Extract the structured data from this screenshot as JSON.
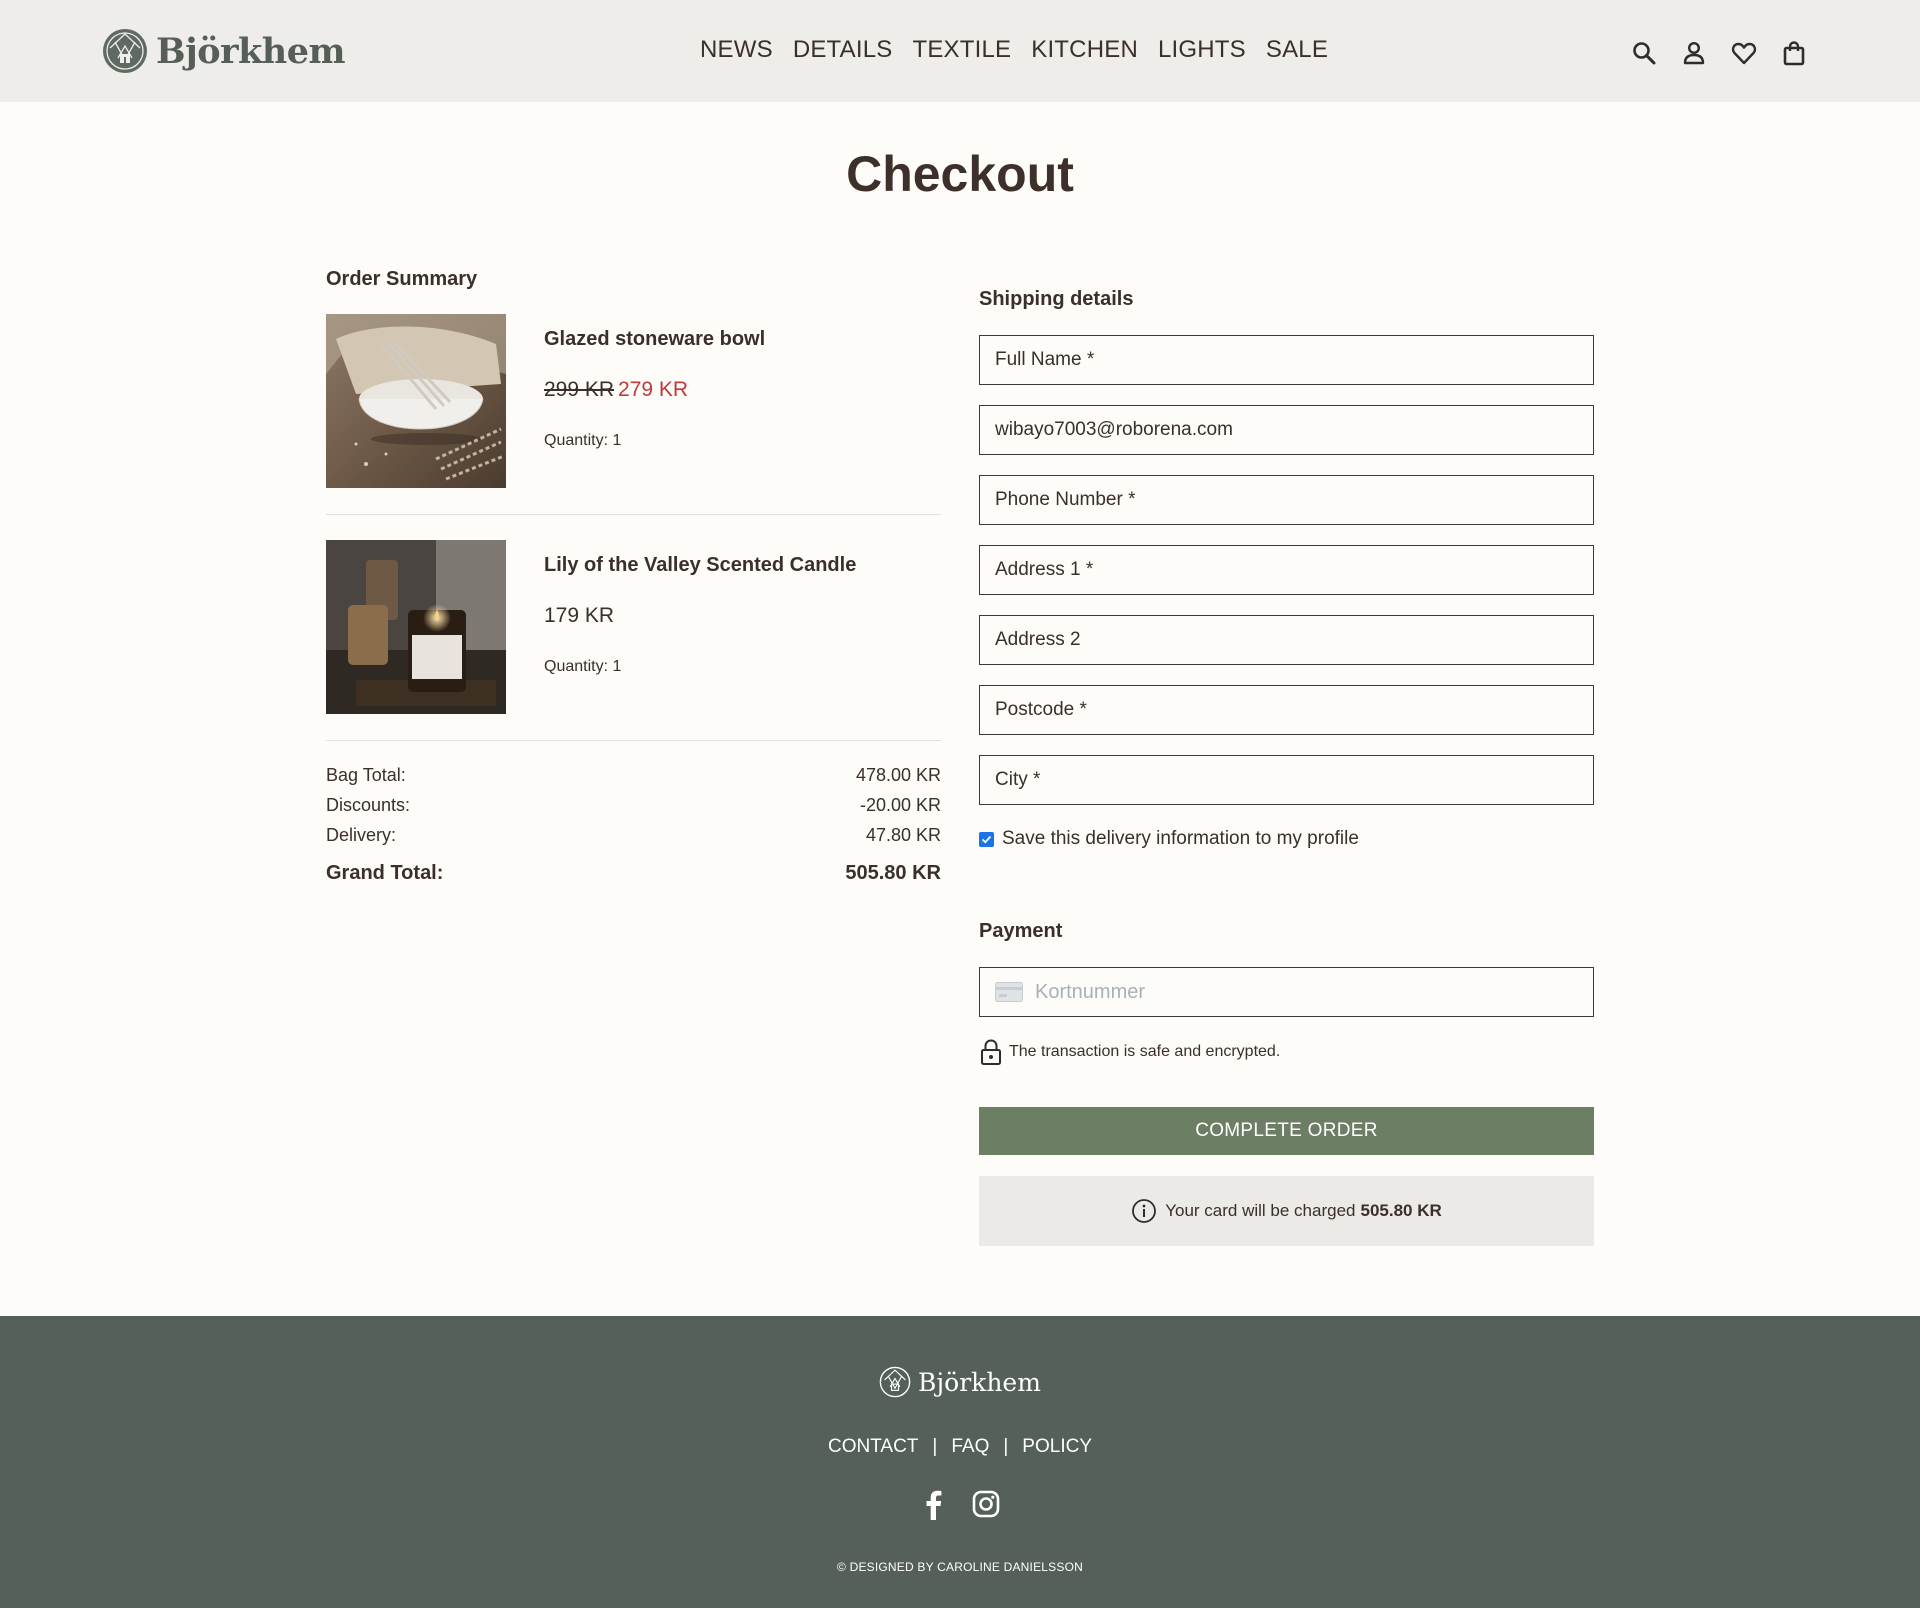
{
  "brand": {
    "name": "Björkhem"
  },
  "nav": [
    "NEWS",
    "DETAILS",
    "TEXTILE",
    "KITCHEN",
    "LIGHTS",
    "SALE"
  ],
  "header_icons": [
    "search-icon",
    "user-icon",
    "heart-icon",
    "bag-icon"
  ],
  "page": {
    "title": "Checkout"
  },
  "order": {
    "heading": "Order Summary",
    "items": [
      {
        "name": "Glazed stoneware bowl",
        "old_price": "299 KR",
        "price": "279 KR",
        "quantity": "Quantity: 1"
      },
      {
        "name": "Lily of the Valley Scented Candle",
        "price": "179 KR",
        "quantity": "Quantity: 1"
      }
    ],
    "totals": {
      "bag_label": "Bag Total:",
      "bag_value": "478.00 KR",
      "discount_label": "Discounts:",
      "discount_value": "-20.00 KR",
      "delivery_label": "Delivery:",
      "delivery_value": "47.80 KR",
      "grand_label": "Grand Total:",
      "grand_value": "505.80 KR"
    }
  },
  "shipping": {
    "heading": "Shipping details",
    "full_name": "Full Name *",
    "email": "wibayo7003@roborena.com",
    "phone": "Phone Number *",
    "address1": "Address 1 *",
    "address2": "Address 2",
    "postcode": "Postcode *",
    "city": "City *",
    "save_label": "Save this delivery information to my profile",
    "save_checked": true
  },
  "payment": {
    "heading": "Payment",
    "card_placeholder": "Kortnummer",
    "secure_text": "The transaction is safe and encrypted.",
    "complete_button": "COMPLETE ORDER",
    "charge_text": "Your card will be charged",
    "charge_amount": "505.80 KR"
  },
  "footer": {
    "links": [
      "CONTACT",
      "FAQ",
      "POLICY"
    ],
    "separator": "|",
    "social": [
      "facebook-icon",
      "instagram-icon"
    ],
    "copyright": "© DESIGNED BY CAROLINE DANIELSSON"
  },
  "colors": {
    "header_bg": "#efede9",
    "page_bg": "#fdfcf9",
    "accent_green": "#6c7e64",
    "footer_bg": "#556058",
    "sale_red": "#c0393b",
    "text": "#3a2f2b"
  }
}
